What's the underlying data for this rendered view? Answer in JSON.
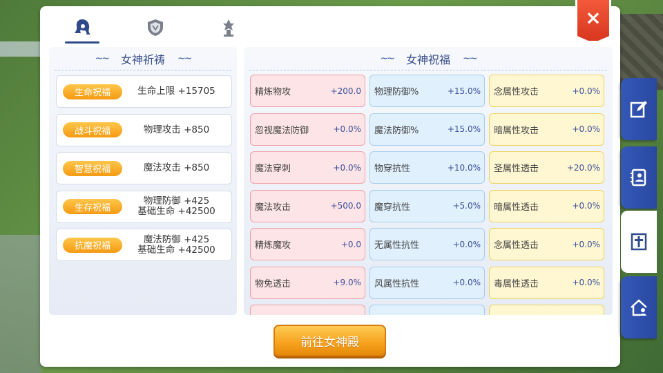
{
  "tabs": [
    {
      "icon": "goddess-icon",
      "active": true
    },
    {
      "icon": "shield-icon",
      "active": false
    },
    {
      "icon": "totem-icon",
      "active": false
    }
  ],
  "close_label": "×",
  "left": {
    "title": "女神祈祷",
    "rows": [
      {
        "badge": "生命祝福",
        "line1": "生命上限 +15705",
        "line2": ""
      },
      {
        "badge": "战斗祝福",
        "line1": "物理攻击 +850",
        "line2": ""
      },
      {
        "badge": "智慧祝福",
        "line1": "魔法攻击 +850",
        "line2": ""
      },
      {
        "badge": "生存祝福",
        "line1": "物理防御 +425",
        "line2": "基础生命 +42500"
      },
      {
        "badge": "抗魔祝福",
        "line1": "魔法防御 +425",
        "line2": "基础生命 +42500"
      }
    ]
  },
  "right": {
    "title": "女神祝福",
    "columns": [
      [
        {
          "label": "精炼物攻",
          "value": "+200.0"
        },
        {
          "label": "忽视魔法防御",
          "value": "+0.0%"
        },
        {
          "label": "魔法穿刺",
          "value": "+0.0%"
        },
        {
          "label": "魔法攻击",
          "value": "+500.0"
        },
        {
          "label": "精炼魔攻",
          "value": "+0.0"
        },
        {
          "label": "物免透击",
          "value": "+9.0%"
        }
      ],
      [
        {
          "label": "物理防御%",
          "value": "+15.0%"
        },
        {
          "label": "魔法防御%",
          "value": "+15.0%"
        },
        {
          "label": "物穿抗性",
          "value": "+10.0%"
        },
        {
          "label": "魔穿抗性",
          "value": "+5.0%"
        },
        {
          "label": "无属性抗性",
          "value": "+0.0%"
        },
        {
          "label": "风属性抗性",
          "value": "+0.0%"
        }
      ],
      [
        {
          "label": "念属性攻击",
          "value": "+0.0%"
        },
        {
          "label": "暗属性攻击",
          "value": "+0.0%"
        },
        {
          "label": "圣属性透击",
          "value": "+20.0%"
        },
        {
          "label": "暗属性透击",
          "value": "+0.0%"
        },
        {
          "label": "念属性透击",
          "value": "+0.0%"
        },
        {
          "label": "毒属性透击",
          "value": "+0.0%"
        }
      ]
    ]
  },
  "go_button": "前往女神殿",
  "side_tabs": [
    {
      "icon": "edit-icon",
      "active": false
    },
    {
      "icon": "contacts-icon",
      "active": false
    },
    {
      "icon": "cross-icon",
      "active": true
    },
    {
      "icon": "home-user-icon",
      "active": false
    }
  ],
  "colors": {
    "accent": "#2f4a8a",
    "badge": "#f59a12",
    "close": "#e0412a"
  }
}
